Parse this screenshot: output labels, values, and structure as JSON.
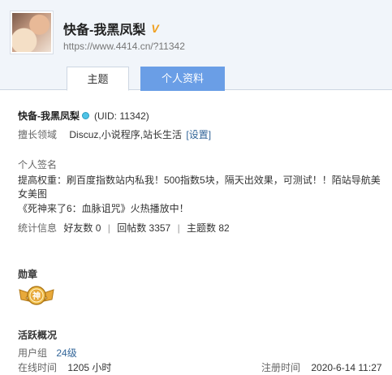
{
  "header": {
    "username": "快备-我黑凤梨",
    "vip_badge": "V",
    "url": "https://www.4414.cn/?11342"
  },
  "tabs": [
    {
      "label": "主题",
      "active": false
    },
    {
      "label": "个人资料",
      "active": true
    }
  ],
  "profile": {
    "name": "快备-我黑凤梨",
    "uid": "(UID: 11342)",
    "expertise_label": "擅长领域",
    "expertise_value": "Discuz,小说程序,站长生活",
    "settings_link": "[设置]",
    "signature_label": "个人签名",
    "signature_line1": "提高权重：刷百度指数站内私我！500指数5块，隔天出效果，可测试！！陌站导航美女美图",
    "signature_line2": "《死神来了6：血脉诅咒》火热播放中！",
    "stats_label": "统计信息",
    "friends": "好友数 0",
    "replies": "回帖数 3357",
    "topics": "主题数 82"
  },
  "medals": {
    "title": "勋章",
    "medal_text": "神"
  },
  "activity": {
    "title": "活跃概况",
    "group_label": "用户组",
    "group_value": "24级",
    "online_label": "在线时间",
    "online_value": "1205 小时",
    "register_label": "注册时间",
    "register_value": "2020-6-14 11:27"
  },
  "colors": {
    "header_bg": "#f1f5fa",
    "tab_active": "#6a9ee6",
    "link": "#336699",
    "vip": "#f0a020",
    "medal": "#e8a93a"
  }
}
